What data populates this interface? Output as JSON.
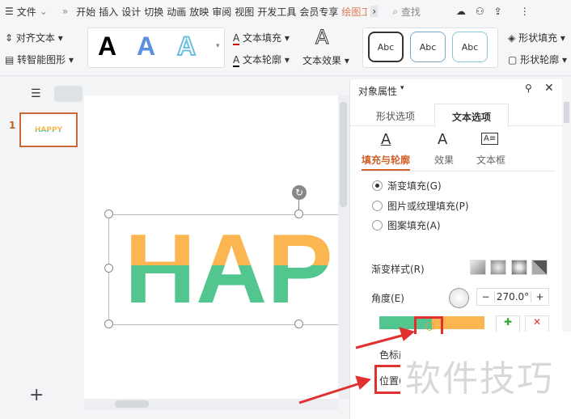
{
  "menu": {
    "file": "文件",
    "tabs": [
      "开始",
      "插入",
      "设计",
      "切换",
      "动画",
      "放映",
      "审阅",
      "视图",
      "开发工具",
      "会员专享",
      "绘图工"
    ],
    "active_tab": "绘图工",
    "search": "查找"
  },
  "ribbon": {
    "align_text": "对齐文本",
    "smart_shape": "转智能图形",
    "text_fill": "文本填充",
    "text_outline": "文本轮廓",
    "text_effect": "文本效果",
    "style_letter": "A",
    "shape_styles": [
      "Abc",
      "Abc",
      "Abc"
    ],
    "shape_fill": "形状填充",
    "shape_outline": "形状轮廓"
  },
  "slides": {
    "number": "1",
    "thumb_text": "HAPPY"
  },
  "slide": {
    "text": "HAPPY",
    "top_color": "#fbb651",
    "bottom_color": "#52c68e"
  },
  "panel": {
    "title": "对象属性",
    "tabs": [
      "形状选项",
      "文本选项"
    ],
    "active_tab": "文本选项",
    "subtabs": [
      "填充与轮廓",
      "效果",
      "文本框"
    ],
    "fill_options": [
      "渐变填充(G)",
      "图片或纹理填充(P)",
      "图案填充(A)"
    ],
    "selected_fill": "渐变填充(G)",
    "gradient_style": "渐变样式(R)",
    "angle_label": "角度(E)",
    "angle_value": "270.0°",
    "stop_color_label": "色标颜",
    "position_label": "位置("
  },
  "watermark": "软件技巧",
  "colors": {
    "accent": "#d0602a",
    "annotation": "#e03030"
  }
}
